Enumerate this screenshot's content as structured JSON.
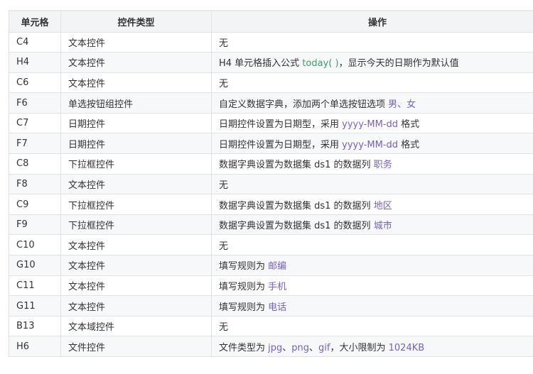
{
  "table": {
    "headers": [
      "单元格",
      "控件类型",
      "操作"
    ],
    "rows": [
      {
        "cell": "C4",
        "type": "文本控件",
        "op_parts": [
          {
            "t": "无"
          }
        ]
      },
      {
        "cell": "H4",
        "type": "文本控件",
        "op_parts": [
          {
            "t": "H4 单元格插入公式 "
          },
          {
            "t": "today( )",
            "hl": "green"
          },
          {
            "t": "，显示今天的日期作为默认值"
          }
        ]
      },
      {
        "cell": "C6",
        "type": "文本控件",
        "op_parts": [
          {
            "t": "无"
          }
        ]
      },
      {
        "cell": "F6",
        "type": "单选按钮组控件",
        "op_parts": [
          {
            "t": "自定义数据字典，添加两个单选按钮选项 "
          },
          {
            "t": "男、女",
            "hl": "purple"
          }
        ]
      },
      {
        "cell": "C7",
        "type": "日期控件",
        "op_parts": [
          {
            "t": "日期控件设置为日期型，采用 "
          },
          {
            "t": "yyyy-MM-dd",
            "hl": "purple"
          },
          {
            "t": " 格式"
          }
        ]
      },
      {
        "cell": "F7",
        "type": "日期控件",
        "op_parts": [
          {
            "t": "日期控件设置为日期型，采用 "
          },
          {
            "t": "yyyy-MM-dd",
            "hl": "purple"
          },
          {
            "t": " 格式"
          }
        ]
      },
      {
        "cell": "C8",
        "type": "下拉框控件",
        "op_parts": [
          {
            "t": "数据字典设置为数据集 ds1 的数据列 "
          },
          {
            "t": "职务",
            "hl": "purple"
          }
        ]
      },
      {
        "cell": "F8",
        "type": "文本控件",
        "op_parts": [
          {
            "t": "无"
          }
        ]
      },
      {
        "cell": "C9",
        "type": "下拉框控件",
        "op_parts": [
          {
            "t": "数据字典设置为数据集 ds1 的数据列 "
          },
          {
            "t": "地区",
            "hl": "purple"
          }
        ]
      },
      {
        "cell": "F9",
        "type": "下拉框控件",
        "op_parts": [
          {
            "t": "数据字典设置为数据集 ds1 的数据列 "
          },
          {
            "t": "城市",
            "hl": "purple"
          }
        ]
      },
      {
        "cell": "C10",
        "type": "文本控件",
        "op_parts": [
          {
            "t": "无"
          }
        ]
      },
      {
        "cell": "G10",
        "type": "文本控件",
        "op_parts": [
          {
            "t": "填写规则为 "
          },
          {
            "t": "邮编",
            "hl": "purple"
          }
        ]
      },
      {
        "cell": "C11",
        "type": "文本控件",
        "op_parts": [
          {
            "t": "填写规则为 "
          },
          {
            "t": "手机",
            "hl": "purple"
          }
        ]
      },
      {
        "cell": "G11",
        "type": "文本控件",
        "op_parts": [
          {
            "t": "填写规则为 "
          },
          {
            "t": "电话",
            "hl": "purple"
          }
        ]
      },
      {
        "cell": "B13",
        "type": "文本域控件",
        "op_parts": [
          {
            "t": "无"
          }
        ]
      },
      {
        "cell": "H6",
        "type": "文件控件",
        "op_parts": [
          {
            "t": "文件类型为 "
          },
          {
            "t": "jpg",
            "hl": "purple"
          },
          {
            "t": "、"
          },
          {
            "t": "png",
            "hl": "purple"
          },
          {
            "t": "、"
          },
          {
            "t": "gif",
            "hl": "purple"
          },
          {
            "t": "，大小限制为 "
          },
          {
            "t": "1024KB",
            "hl": "purple"
          }
        ]
      }
    ]
  },
  "colors": {
    "highlight": "#7a5fc7",
    "formula": "#3fa06a",
    "header_bg": "#f3f4f6",
    "stripe_bg": "#f6f8fa",
    "border": "#dfe2e5"
  }
}
